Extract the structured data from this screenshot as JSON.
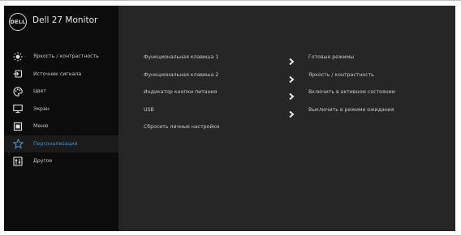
{
  "header": {
    "logo_text": "DELL",
    "title": "Dell 27 Monitor"
  },
  "sidebar": {
    "items": [
      {
        "label": "Яркость / контрастность",
        "icon": "brightness-icon",
        "active": false
      },
      {
        "label": "Источник сигнала",
        "icon": "input-source-icon",
        "active": false
      },
      {
        "label": "Цвет",
        "icon": "palette-icon",
        "active": false
      },
      {
        "label": "Экран",
        "icon": "display-icon",
        "active": false
      },
      {
        "label": "Меню",
        "icon": "menu-icon",
        "active": false
      },
      {
        "label": "Персонализация",
        "icon": "star-icon",
        "active": true
      },
      {
        "label": "Другое",
        "icon": "other-settings-icon",
        "active": false
      }
    ]
  },
  "main": {
    "rows": [
      {
        "label": "Функциональная клавиша 1",
        "value": "Готовые режимы",
        "has_arrow": true
      },
      {
        "label": "Функциональная клавиша 2",
        "value": "Яркость / контрастность",
        "has_arrow": true
      },
      {
        "label": "Индикатор кнопки питания",
        "value": "Включить в активном состоянии",
        "has_arrow": true
      },
      {
        "label": "USB",
        "value": "Выключить в режиме ожидания",
        "has_arrow": true
      },
      {
        "label": "Сбросить личные настройки",
        "value": "",
        "has_arrow": false
      }
    ]
  },
  "colors": {
    "panel": "#262626",
    "sidebar": "#0c0c0c",
    "accent": "#4b90c6",
    "text": "#c9c9c9"
  }
}
